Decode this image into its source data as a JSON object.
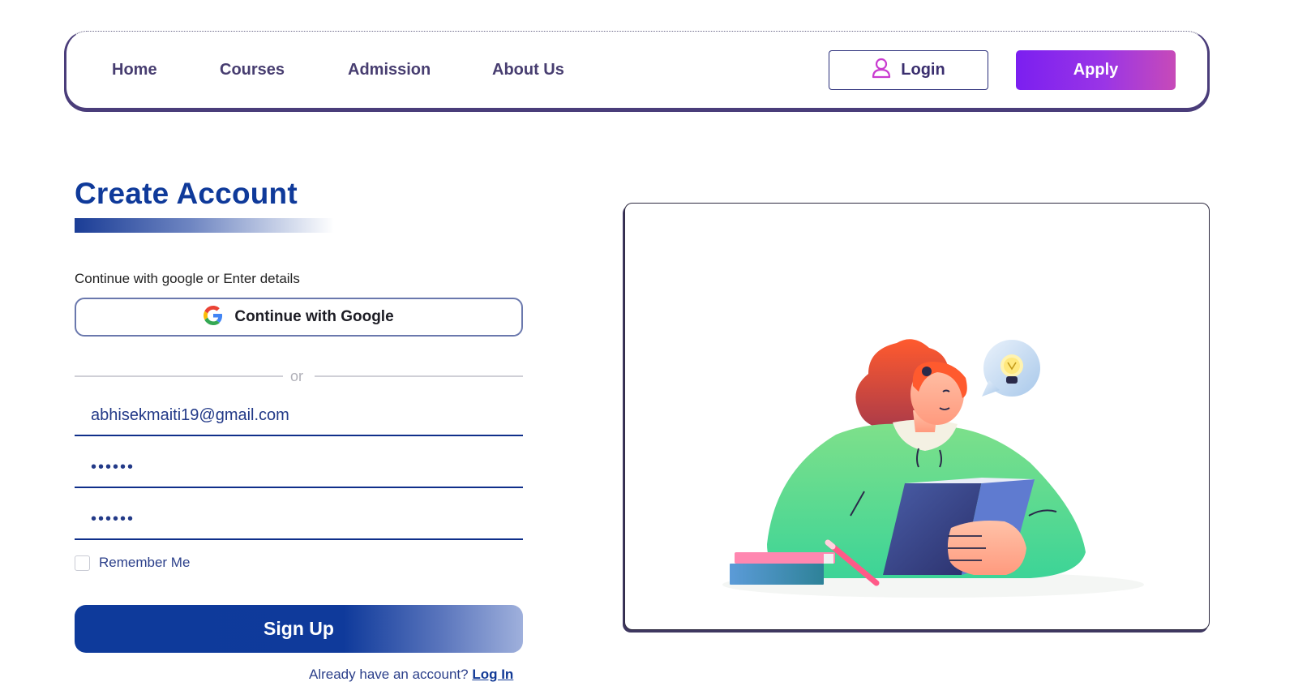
{
  "nav": {
    "links": [
      "Home",
      "Courses",
      "Admission",
      "About Us"
    ],
    "login_label": "Login",
    "apply_label": "Apply"
  },
  "form": {
    "title": "Create Account",
    "subtitle": "Continue with google or Enter details",
    "google_label": "Continue with Google",
    "divider": "or",
    "email_value": "abhisekmaiti19@gmail.com",
    "password_value": "••••••",
    "confirm_password_value": "••••••",
    "remember_label": "Remember Me",
    "signup_label": "Sign Up",
    "already_text": "Already have an account?",
    "login_link": "Log In"
  },
  "colors": {
    "primary": "#0f3a9b",
    "accent_purple": "#7b1ff0",
    "nav_text": "#473d70"
  },
  "icons": [
    "user-icon",
    "google-icon",
    "lightbulb-icon"
  ]
}
